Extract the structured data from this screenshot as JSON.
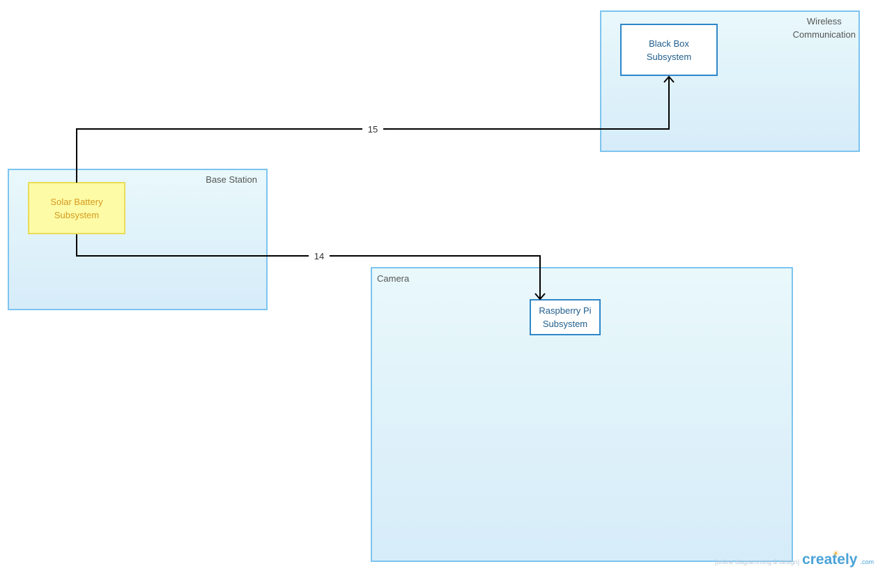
{
  "groups": {
    "wireless": {
      "label": "Wireless\nCommunication"
    },
    "base_station": {
      "label": "Base Station"
    },
    "camera": {
      "label": "Camera"
    }
  },
  "nodes": {
    "black_box": {
      "label": "Black Box\nSubsystem"
    },
    "solar_battery": {
      "label": "Solar Battery\nSubsystem"
    },
    "raspberry_pi": {
      "label": "Raspberry Pi\nSubsystem"
    }
  },
  "connectors": {
    "c15": {
      "label": "15",
      "from": "Solar Battery Subsystem",
      "to": "Black Box Subsystem"
    },
    "c14": {
      "label": "14",
      "from": "Solar Battery Subsystem",
      "to": "Raspberry Pi Subsystem"
    }
  },
  "colors": {
    "group_border": "#7cc4ef",
    "node_blue": "#2e86c8",
    "node_yellow_border": "#e9dc5a",
    "node_yellow_fill": "#fdfba6",
    "connector": "#000000"
  },
  "watermark": {
    "tagline": "[online diagramming & design]",
    "logo": "creately",
    "suffix": ".com",
    "icon": "lightbulb-icon"
  }
}
